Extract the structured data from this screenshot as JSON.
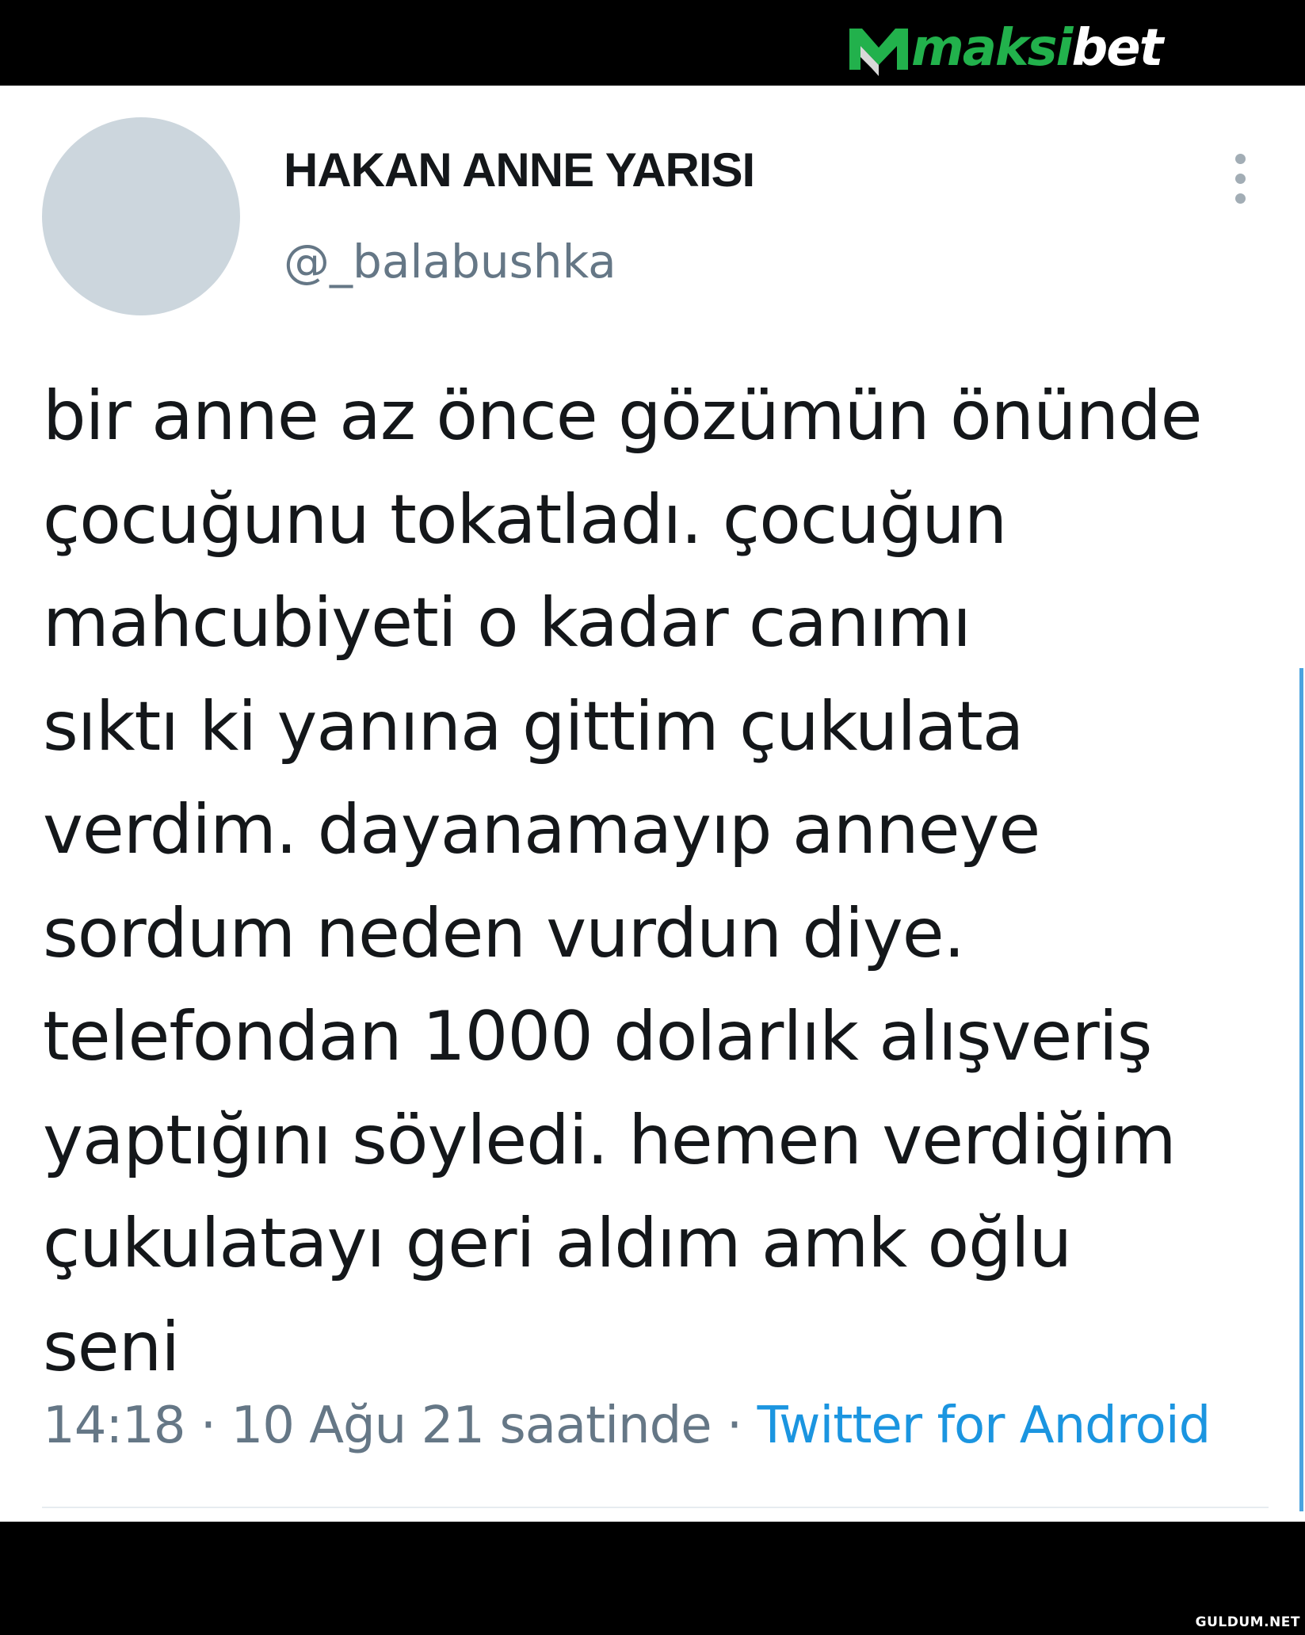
{
  "header": {
    "logo": {
      "text_part1": "maksi",
      "text_part2": "bet",
      "brand_color": "#22b14c",
      "icon": "maksibet-m-logo-icon"
    }
  },
  "tweet": {
    "author": {
      "display_name": "HAKAN ANNE YARISI",
      "handle": "@_balabushka",
      "avatar_color": "#ccd6dd"
    },
    "menu_icon": "more-vertical-icon",
    "text_lines": [
      "bir anne az önce gözümün önünde",
      "çocuğunu tokatladı. çocuğun",
      "mahcubiyeti o kadar canımı",
      "sıktı ki yanına gittim çukulata",
      "verdim. dayanamayıp anneye",
      "sordum neden vurdun diye.",
      "telefondan 1000 dolarlık alışveriş",
      "yaptığını söyledi. hemen verdiğim",
      "çukulatayı geri aldım amk oğlu",
      "seni"
    ],
    "meta": {
      "time": "14:18",
      "separator1": " · ",
      "date": "10 Ağu 21 saatinde",
      "separator2": " · ",
      "source": "Twitter for Android",
      "source_color": "#1b95e0"
    }
  },
  "footer": {
    "watermark": "GULDUM.NET"
  }
}
